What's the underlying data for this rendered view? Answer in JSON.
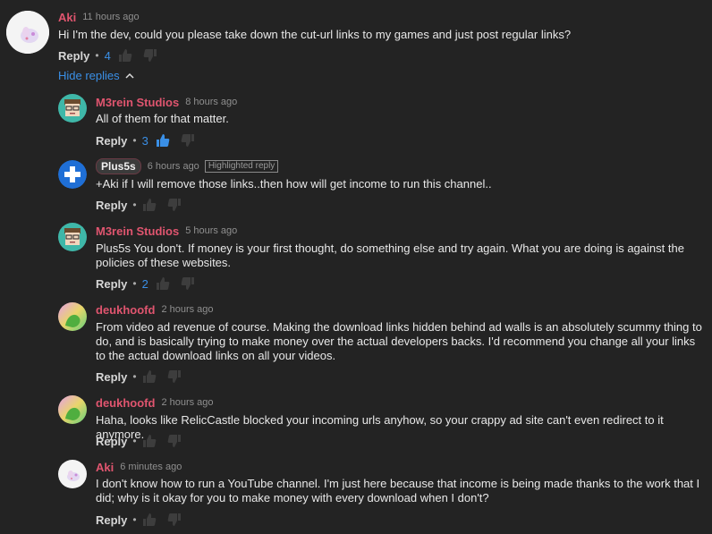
{
  "comments": [
    {
      "author": "Aki",
      "time": "11 hours ago",
      "text": "Hi I'm the dev, could you please take down the cut-url links to my games and just post regular links?",
      "reply_label": "Reply",
      "likes": "4",
      "avatar": "aki-avatar"
    },
    {
      "author": "M3rein Studios",
      "time": "8 hours ago",
      "text": "All of them for that matter.",
      "reply_label": "Reply",
      "likes": "3",
      "avatar": "m3rein-avatar"
    },
    {
      "author": "Plus5s",
      "time": "6 hours ago",
      "badge": "Highlighted reply",
      "text": "+Aki if I will remove those links..then how will get income to run this channel..",
      "reply_label": "Reply",
      "likes": "",
      "avatar": "plus5s-avatar"
    },
    {
      "author": "M3rein Studios",
      "time": "5 hours ago",
      "text": "Plus5s You don't. If money is your first thought, do something else and try again. What you are doing is against the policies of these websites.",
      "reply_label": "Reply",
      "likes": "2",
      "avatar": "m3rein-avatar"
    },
    {
      "author": "deukhoofd",
      "time": "2 hours ago",
      "text": "From video ad revenue of course. Making the download links hidden behind ad walls is an absolutely scummy thing to do, and is basically trying to make money over the actual developers backs. I'd recommend you change all your links to the actual download links on all your videos.",
      "reply_label": "Reply",
      "likes": "",
      "avatar": "deukhoofd-avatar"
    },
    {
      "author": "deukhoofd",
      "time": "2 hours ago",
      "text": "Haha, looks like RelicCastle blocked your incoming urls anyhow, so your crappy ad site can't even redirect to it anymore.",
      "reply_label": "Reply",
      "likes": "",
      "avatar": "deukhoofd-avatar"
    },
    {
      "author": "Aki",
      "time": "6 minutes ago",
      "text": "I don't know how to run a YouTube channel. I'm just here because that income is being made thanks to the work that I did; why is it okay for you to make money with every download when I don't?",
      "reply_label": "Reply",
      "likes": "",
      "avatar": "aki-avatar"
    }
  ],
  "hide_replies_label": "Hide replies",
  "colors": {
    "background": "#232323",
    "author": "#e0556f",
    "link": "#3a8fe6",
    "liked": "#3a8fe6"
  }
}
